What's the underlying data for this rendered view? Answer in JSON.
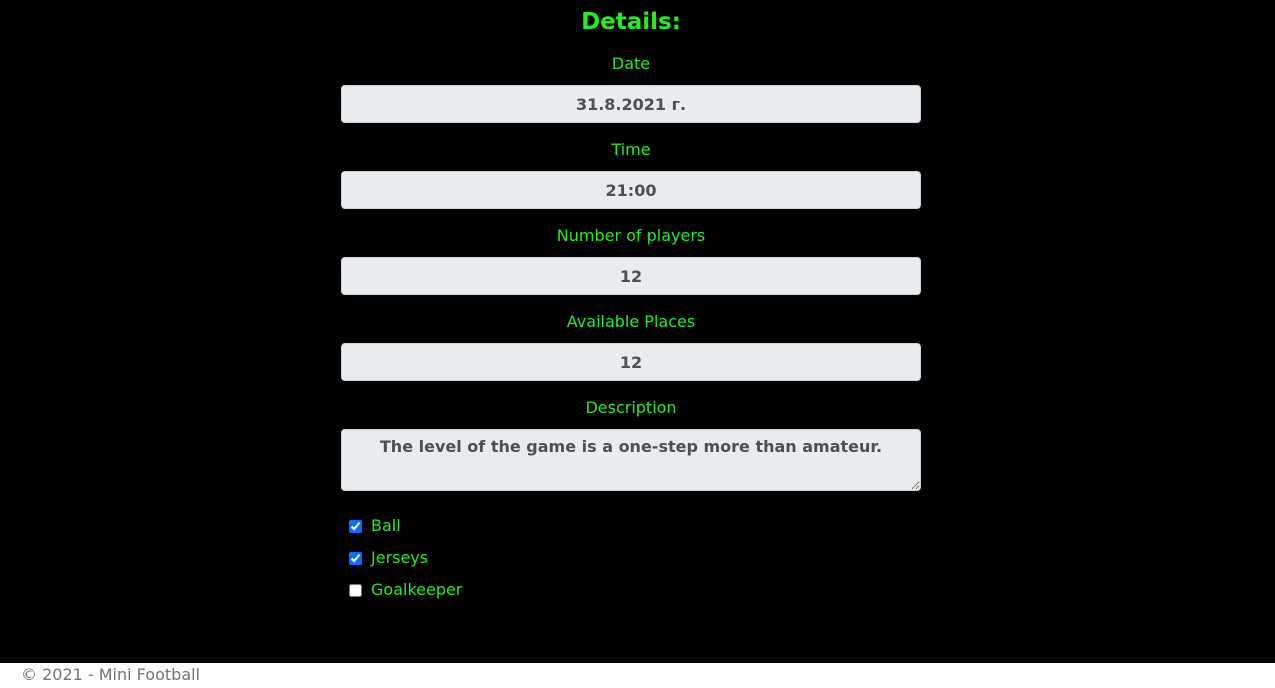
{
  "title": "Details:",
  "fields": {
    "date": {
      "label": "Date",
      "value": "31.8.2021 г."
    },
    "time": {
      "label": "Time",
      "value": "21:00"
    },
    "players": {
      "label": "Number of players",
      "value": "12"
    },
    "places": {
      "label": "Available Places",
      "value": "12"
    },
    "description": {
      "label": "Description",
      "value": "The level of the game is a one-step more than amateur."
    }
  },
  "checkboxes": {
    "ball": {
      "label": "Ball",
      "checked": true
    },
    "jerseys": {
      "label": "Jerseys",
      "checked": true
    },
    "goalkeeper": {
      "label": "Goalkeeper",
      "checked": false
    }
  },
  "footer": {
    "text": "© 2021 - Mini Football"
  },
  "colors": {
    "background": "#000000",
    "label_green": "#22ee22",
    "input_bg": "#e9ecef",
    "input_text": "#495057",
    "checkbox_accent": "#0d6efd",
    "footer_text": "#6c757d"
  }
}
